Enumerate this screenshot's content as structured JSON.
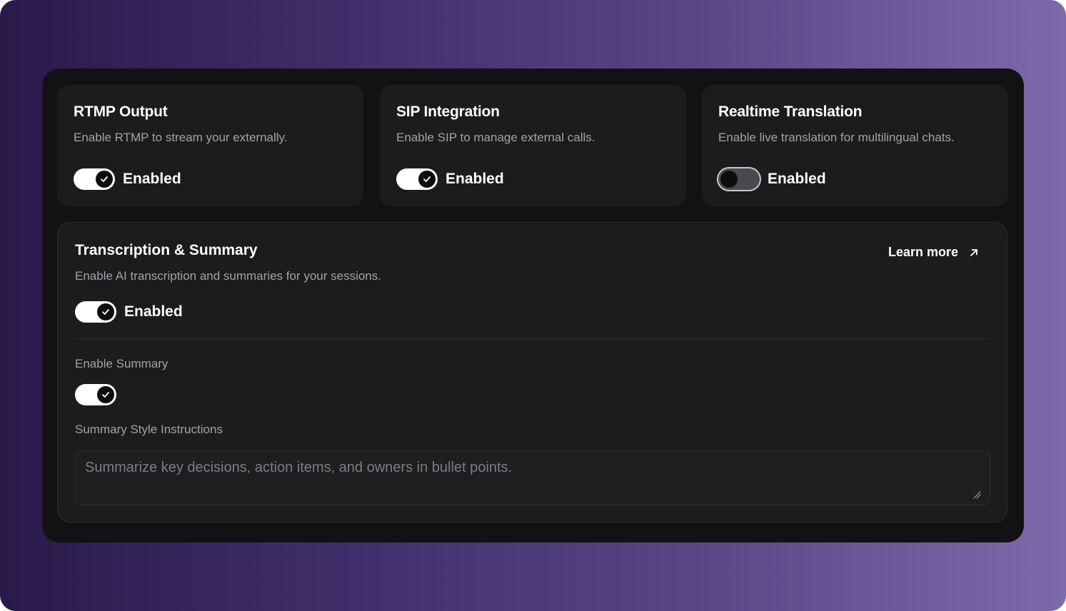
{
  "colors": {
    "accent": "#ffffff",
    "card_bg": "#1c1c1e",
    "panel_bg": "#121214"
  },
  "cards": [
    {
      "title": "RTMP Output",
      "description": "Enable RTMP to stream your externally.",
      "toggle_label": "Enabled",
      "enabled": true
    },
    {
      "title": "SIP Integration",
      "description": "Enable SIP to manage external calls.",
      "toggle_label": "Enabled",
      "enabled": true
    },
    {
      "title": "Realtime Translation",
      "description": "Enable live translation for multilingual chats.",
      "toggle_label": "Enabled",
      "enabled": false
    }
  ],
  "transcription": {
    "title": "Transcription & Summary",
    "description": "Enable AI transcription and summaries for your sessions.",
    "learn_more": "Learn more",
    "learn_more_icon": "arrow-up-right-icon",
    "toggle_label": "Enabled",
    "enabled": true,
    "summary_label": "Enable Summary",
    "summary_enabled": true,
    "instructions_label": "Summary Style Instructions",
    "instructions_placeholder": "Summarize key decisions, action items, and owners in bullet points."
  }
}
